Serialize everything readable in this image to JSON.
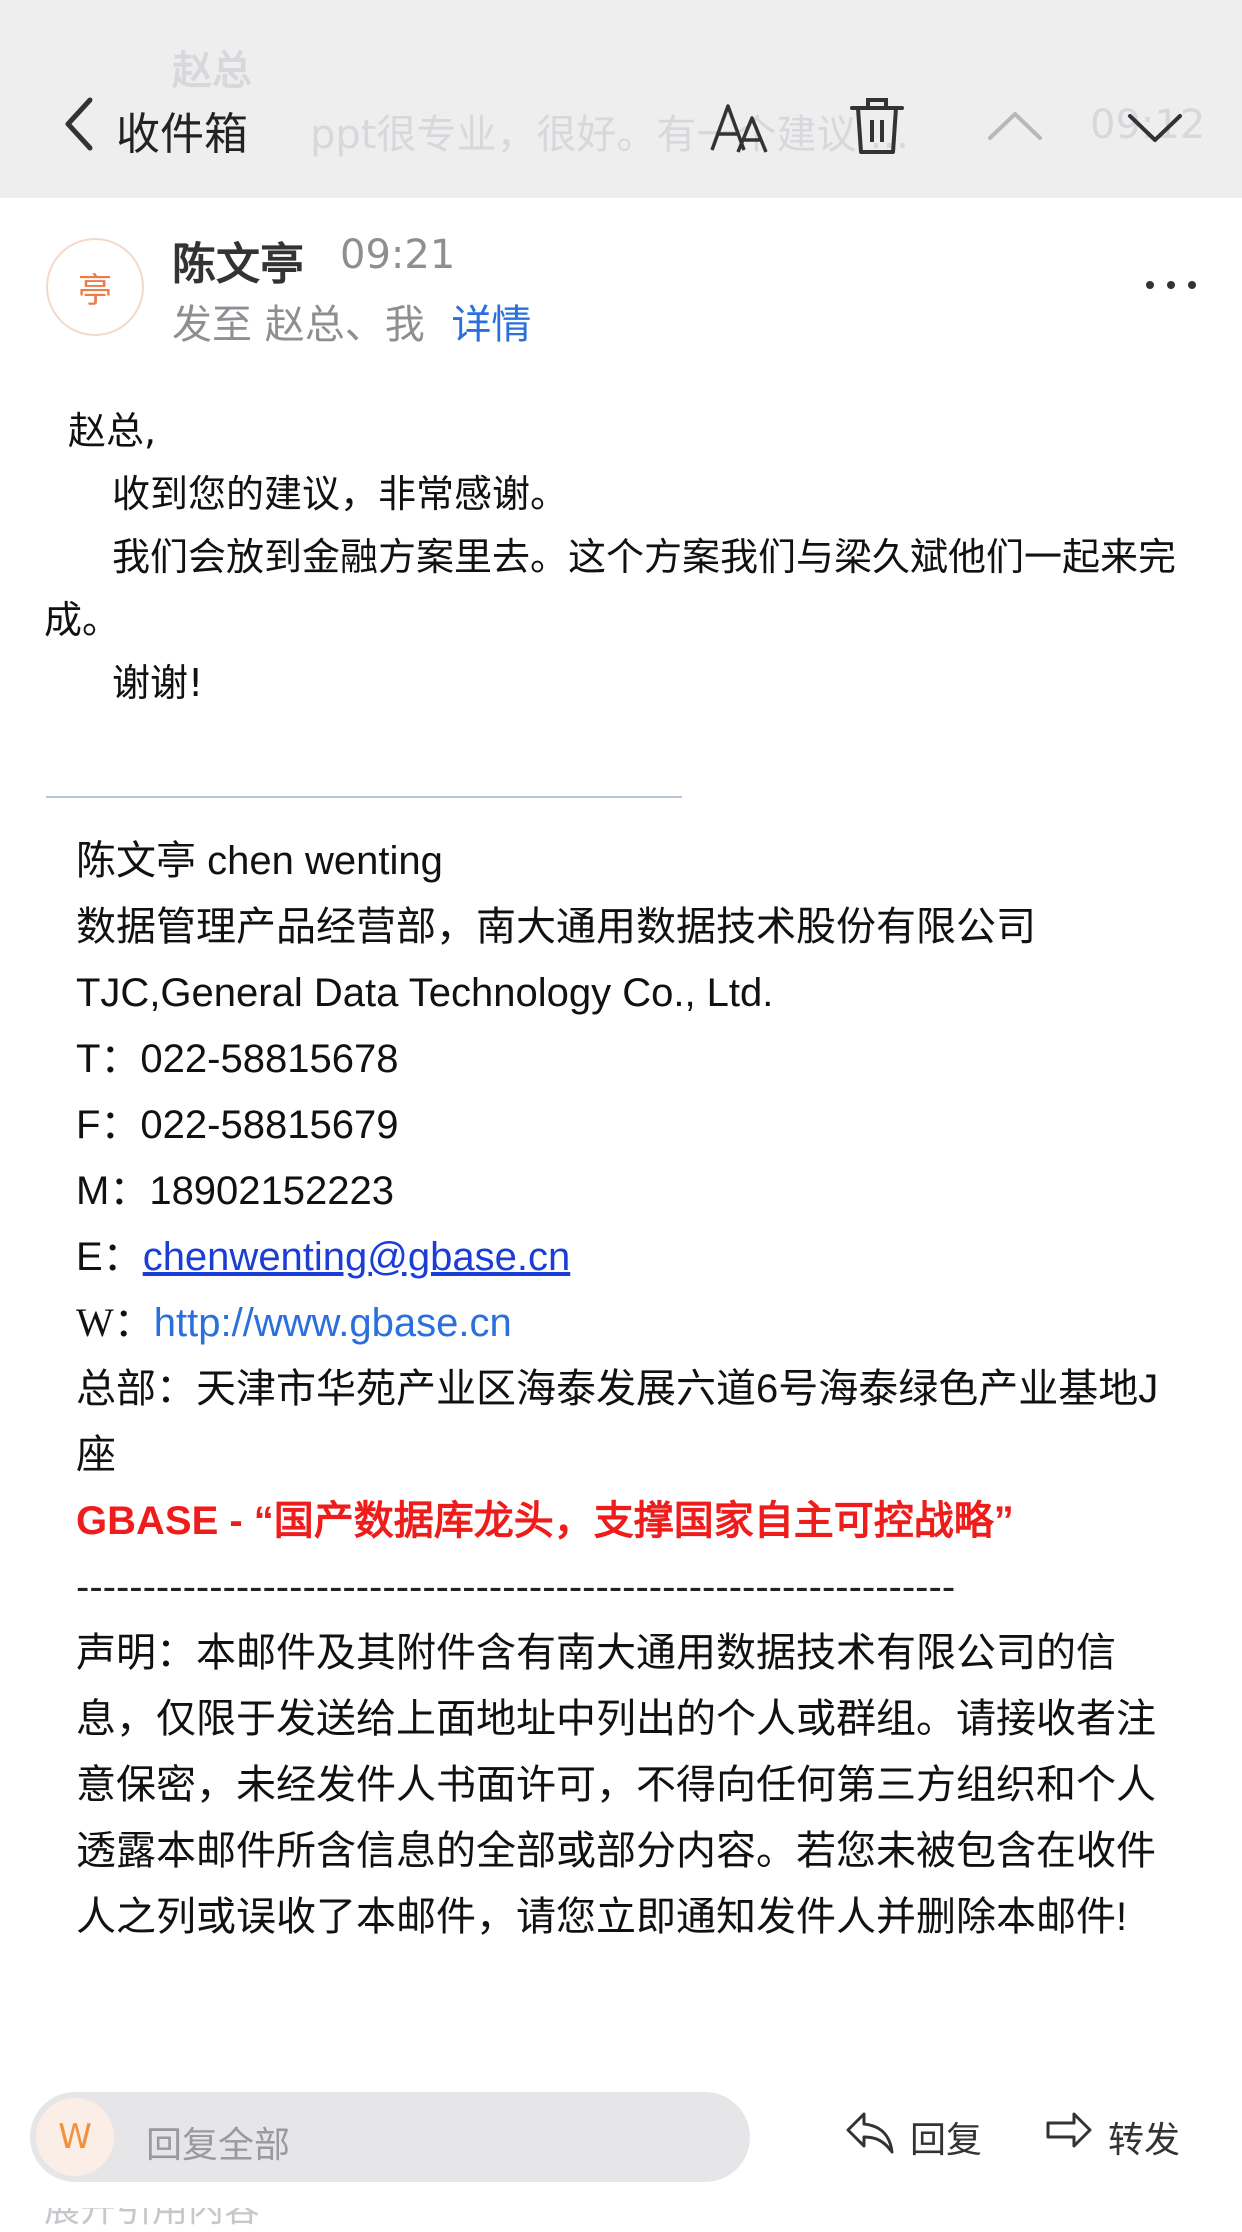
{
  "nav": {
    "back_label": "收件箱",
    "ghost_sender": "赵总",
    "ghost_preview": "ppt很专业，很好。有一个建议 …",
    "ghost_time": "09:12",
    "icons": [
      "chevron-left-icon",
      "font-size-icon",
      "trash-icon",
      "chevron-up-icon",
      "chevron-down-icon"
    ]
  },
  "header": {
    "avatar_char": "亭",
    "sender_name": "陈文亭",
    "time": "09:21",
    "recipients_prefix": "发至",
    "recipients": "赵总、我",
    "details_link": "详情"
  },
  "body": {
    "greeting": "赵总,",
    "p1": "收到您的建议，非常感谢。",
    "p2": "我们会放到金融方案里去。这个方案我们与梁久斌他们一起来完成。",
    "p3": "谢谢!"
  },
  "signature": {
    "name": "陈文亭 chen wenting",
    "dept": "数据管理产品经营部，南大通用数据技术股份有限公司",
    "company_en": "TJC,General Data Technology Co., Ltd.",
    "tel": "T：022-58815678",
    "fax": "F：022-58815679",
    "mobile": "M：18902152223",
    "email_prefix": "E：",
    "email": "chenwenting@gbase.cn",
    "web_prefix": "W：",
    "web": "http://www.gbase.cn",
    "address": "总部：天津市华苑产业区海泰发展六道6号海泰绿色产业基地J座",
    "slogan": "GBASE - “国产数据库龙头，支撑国家自主可控战略”",
    "dashes": "------------------------------------------------------------------",
    "disclaimer": "声明：本邮件及其附件含有南大通用数据技术有限公司的信息，仅限于发送给上面地址中列出的个人或群组。请接收者注意保密，未经发件人书面许可，不得向任何第三方组织和个人透露本邮件所含信息的全部或部分内容。若您未被包含在收件人之列或误收了本邮件，请您立即通知发件人并删除本邮件!"
  },
  "bottom": {
    "reply_avatar_char": "W",
    "reply_all": "回复全部",
    "reply": "回复",
    "forward": "转发",
    "peek_text": "展开引用内容"
  },
  "colors": {
    "link": "#2a6fdb",
    "email_link": "#1a3dd6",
    "slogan": "#ef1c1c",
    "avatar_text": "#f07a47",
    "nav_bg": "#eeeeef"
  }
}
